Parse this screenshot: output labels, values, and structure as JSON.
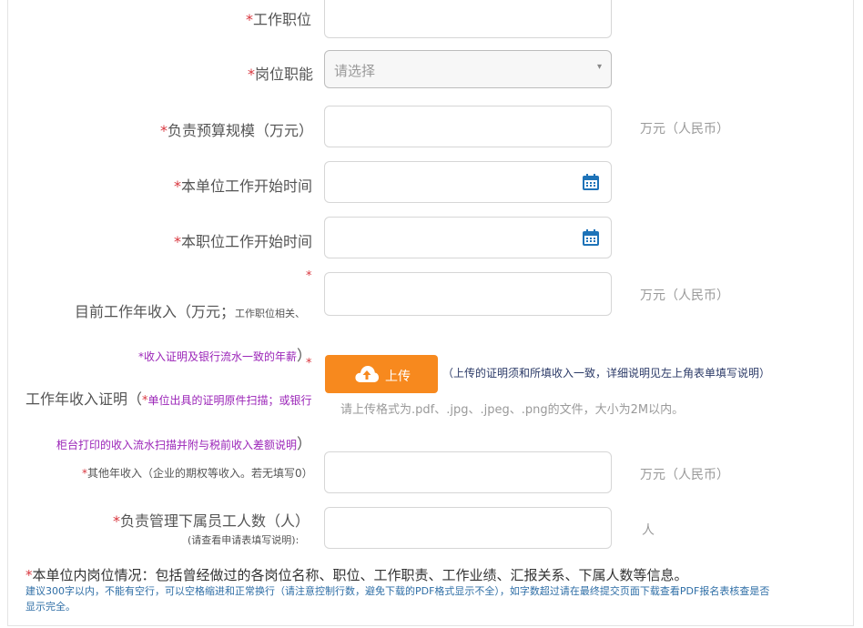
{
  "form": {
    "job_title": {
      "req": "*",
      "label": "工作职位",
      "value": ""
    },
    "job_function": {
      "req": "*",
      "label": "岗位职能",
      "placeholder": "请选择",
      "caret": "▾"
    },
    "budget": {
      "req": "*",
      "label": "负责预算规模（万元）",
      "unit": "万元（人民币）"
    },
    "unit_start": {
      "req": "*",
      "label": "本单位工作开始时间"
    },
    "position_start": {
      "req": "*",
      "label": "本职位工作开始时间"
    },
    "annual_income": {
      "req": "*",
      "label": "目前工作年收入（万元；",
      "label_small": "工作职位相关、",
      "label_note": "*收入证明及银行流水一致的年薪",
      "label_close": "）",
      "unit": "万元（人民币）"
    },
    "income_proof": {
      "req": "*",
      "label": "工作年收入证明（",
      "label_star": "*",
      "label_note1": "单位出具的证明原件扫描；或银行",
      "label_note2": "柜台打印的收入流水扫描并附与税前收入差额说明",
      "label_close": "）",
      "upload_label": "上传",
      "upload_hint": "（上传的证明须和所填收入一致，详细说明见左上角表单填写说明）",
      "format_hint": "请上传格式为.pdf、.jpg、.jpeg、.png的文件，大小为2M以内。"
    },
    "other_income": {
      "req": "*",
      "label": "其他年收入（企业的期权等收入。若无填写0）",
      "unit": "万元（人民币）"
    },
    "subordinates": {
      "req": "*",
      "label": "负责管理下属员工人数（人）",
      "label_small": "(请查看申请表填写说明):",
      "unit": "人"
    },
    "position_desc": {
      "req": "*",
      "label": "本单位内岗位情况：包括曾经做过的各岗位名称、职位、工作职责、工作业绩、汇报关系、下属人数等信息。",
      "note_line1": "建议300字以内，不能有空行，可以空格缩进和正常换行（请注意控制行数，避免下载的PDF格式显示不全），如字数超过请在最终提交页面下载查看PDF报名表核查是否",
      "note_line2": "显示完全。"
    }
  },
  "colors": {
    "accent": "#f7891e",
    "required": "#d9363e",
    "note_purple": "#9b25b8",
    "note_blue": "#2e6ea6",
    "calendar": "#1e73b8"
  },
  "icons": {
    "calendar": "calendar-icon",
    "upload": "cloud-upload-icon",
    "dropdown": "chevron-down-icon"
  }
}
